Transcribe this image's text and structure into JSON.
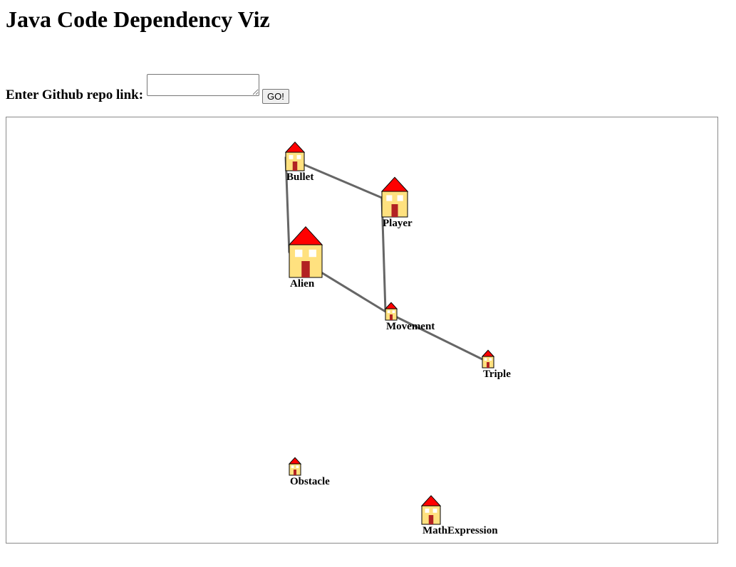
{
  "header": {
    "title": "Java Code Dependency Viz"
  },
  "repo_form": {
    "label": "Enter Github repo link:",
    "input_value": "",
    "input_placeholder": "",
    "go_label": "GO!"
  },
  "colors": {
    "roof": "#ff0000",
    "wall": "#ffe17f",
    "door": "#b22222",
    "window": "#ffffff",
    "edge": "#666666",
    "outline": "#000000"
  },
  "graph": {
    "node_icon": "house-icon",
    "nodes": [
      {
        "id": "Bullet",
        "label": "Bullet",
        "weight": 2
      },
      {
        "id": "Player",
        "label": "Player",
        "weight": 3
      },
      {
        "id": "Alien",
        "label": "Alien",
        "weight": 4
      },
      {
        "id": "Movement",
        "label": "Movement",
        "weight": 1
      },
      {
        "id": "Triple",
        "label": "Triple",
        "weight": 1
      },
      {
        "id": "Obstacle",
        "label": "Obstacle",
        "weight": 1
      },
      {
        "id": "MathExpression",
        "label": "MathExpression",
        "weight": 2
      }
    ],
    "edges": [
      {
        "source": "Bullet",
        "target": "Player"
      },
      {
        "source": "Bullet",
        "target": "Alien"
      },
      {
        "source": "Player",
        "target": "Movement"
      },
      {
        "source": "Alien",
        "target": "Movement"
      },
      {
        "source": "Movement",
        "target": "Triple"
      }
    ]
  }
}
